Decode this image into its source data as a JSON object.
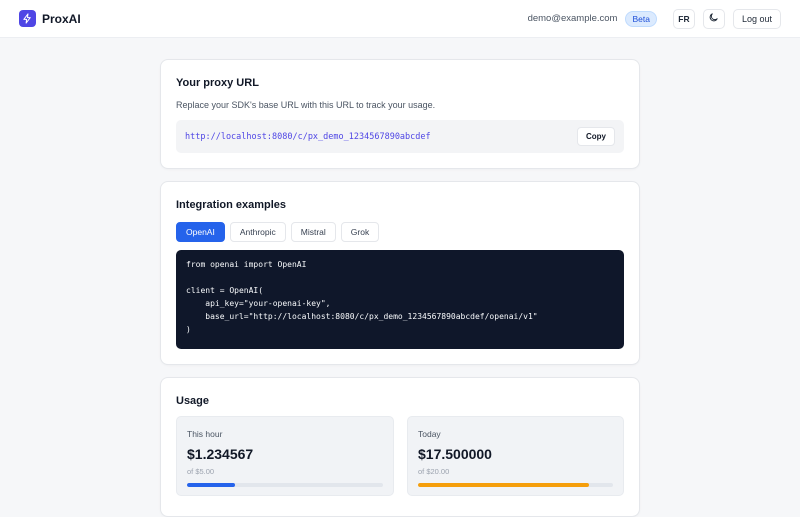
{
  "app": {
    "name": "ProxAI",
    "logo_icon": "bolt-icon",
    "accent": "#4f46e5"
  },
  "header": {
    "email": "demo@example.com",
    "badge": "Beta",
    "language": "FR",
    "theme_icon": "moon-icon",
    "logout_label": "Log out"
  },
  "proxy": {
    "title": "Your proxy URL",
    "description": "Replace your SDK's base URL with this URL to track your usage.",
    "url": "http://localhost:8080/c/px_demo_1234567890abcdef",
    "copy_label": "Copy"
  },
  "integration": {
    "title": "Integration examples",
    "tabs": [
      {
        "label": "OpenAI",
        "active": true
      },
      {
        "label": "Anthropic",
        "active": false
      },
      {
        "label": "Mistral",
        "active": false
      },
      {
        "label": "Grok",
        "active": false
      }
    ],
    "code": "from openai import OpenAI\n\nclient = OpenAI(\n    api_key=\"your-openai-key\",\n    base_url=\"http://localhost:8080/c/px_demo_1234567890abcdef/openai/v1\"\n)"
  },
  "usage": {
    "title": "Usage",
    "stats": [
      {
        "label": "This hour",
        "value": "$1.234567",
        "limit": "of $5.00",
        "progress": 0.247,
        "color": "#2563eb"
      },
      {
        "label": "Today",
        "value": "$17.500000",
        "limit": "of $20.00",
        "progress": 0.875,
        "color": "#f59e0b"
      }
    ]
  }
}
